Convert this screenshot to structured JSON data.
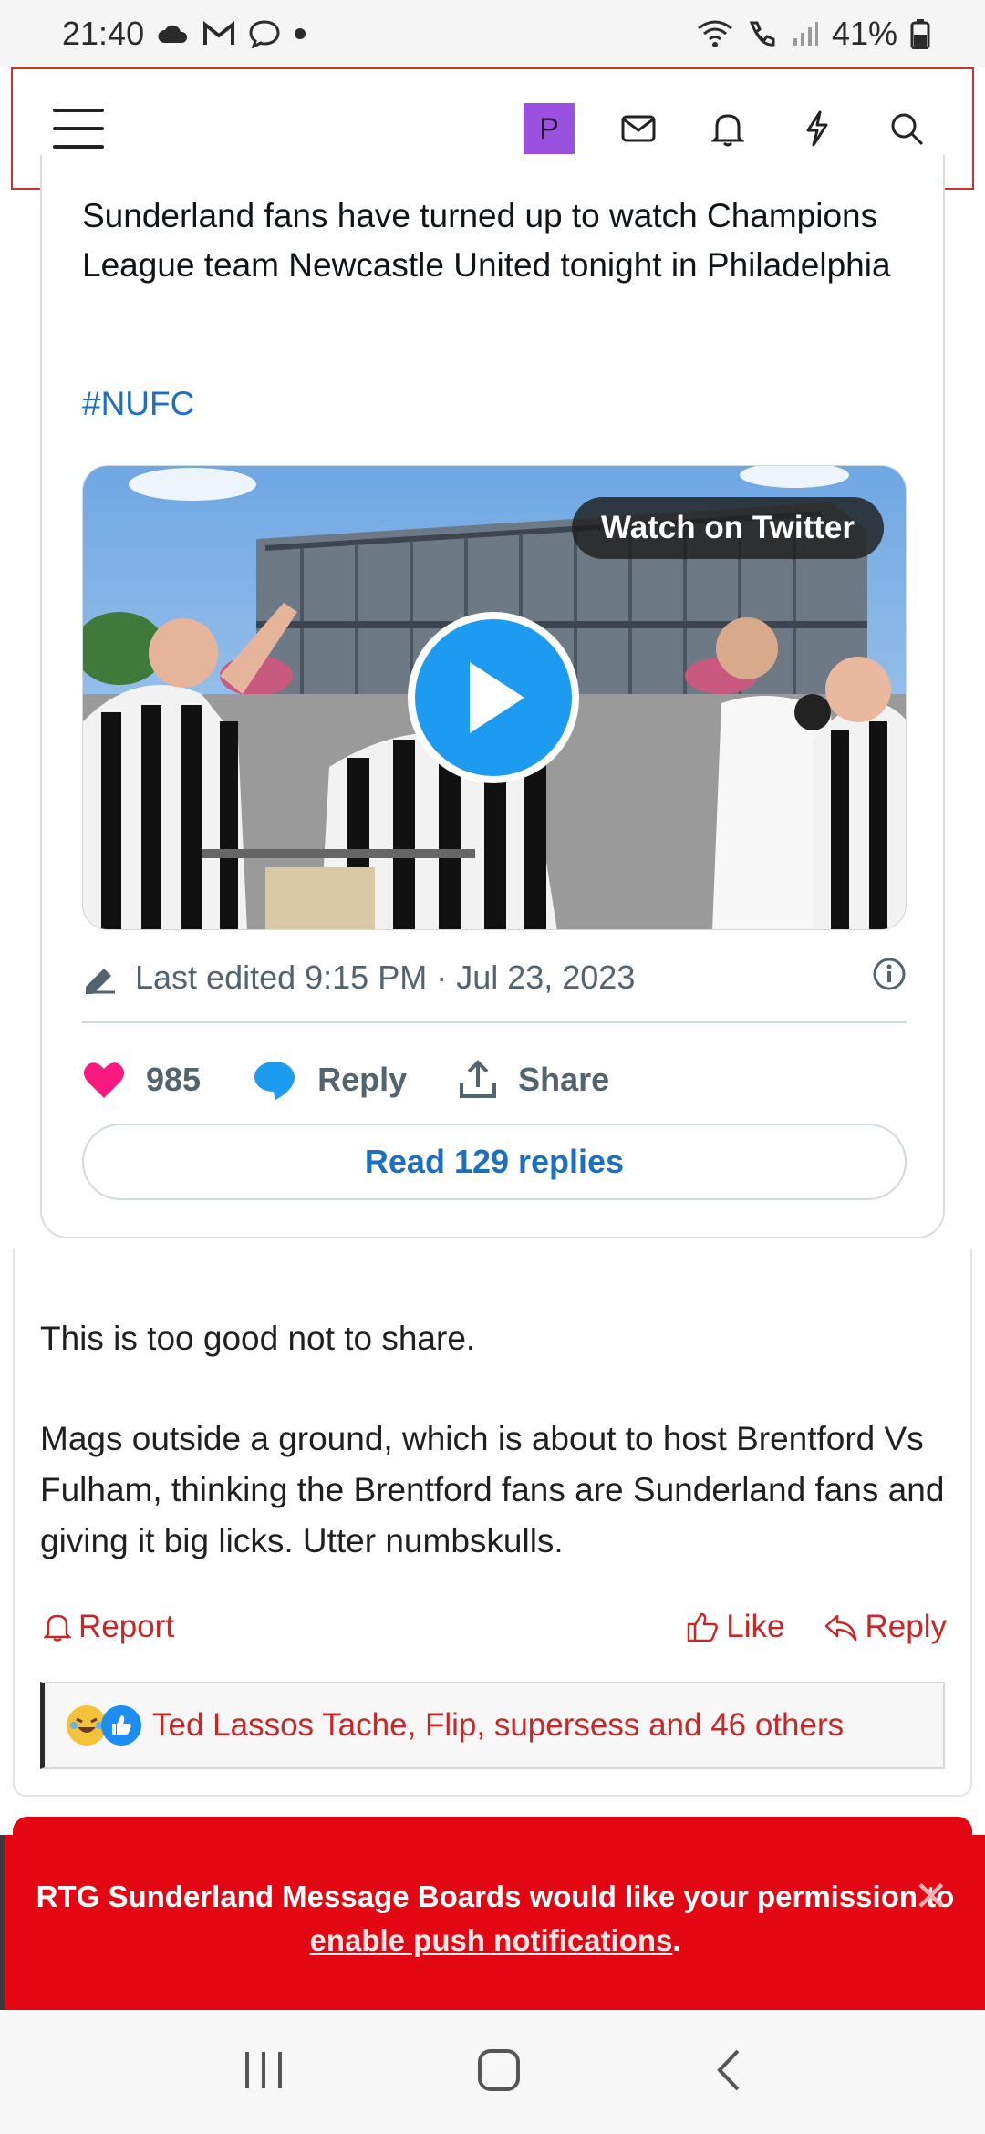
{
  "status_bar": {
    "time": "21:40",
    "battery": "41%",
    "icons": [
      "cloud-icon",
      "gmail-icon",
      "chat-bubble-icon",
      "dot-icon",
      "wifi-icon",
      "call-icon",
      "signal-icon",
      "battery-icon"
    ]
  },
  "header": {
    "avatar_letter": "P",
    "icons": [
      "menu-icon",
      "mail-icon",
      "bell-icon",
      "lightning-icon",
      "search-icon"
    ],
    "avatar_color": "#9b51e0"
  },
  "tweet": {
    "text": "Sunderland fans have turned up to watch Champions League team Newcastle United tonight in Philadelphia",
    "hashtag": "#NUFC",
    "watch_label": "Watch on Twitter",
    "edited": "Last edited 9:15 PM · Jul 23, 2023",
    "likes": "985",
    "reply_label": "Reply",
    "share_label": "Share",
    "read_replies": "Read 129 replies"
  },
  "post": {
    "paragraph1": "This is too good not to share.",
    "paragraph2": "Mags outside a ground, which is about to host Brentford Vs Fulham, thinking the Brentford fans are Sunderland fans and giving it big licks. Utter numbskulls.",
    "report_label": "Report",
    "like_label": "Like",
    "reply_label": "Reply",
    "reactions_text": "Ted Lassos Tache, Flip, supersess and 46 others"
  },
  "notification": {
    "text_before": "RTG Sunderland Message Boards would like your permission to ",
    "link": "enable push notifications",
    "text_after": ".",
    "close": "✕"
  },
  "colors": {
    "accent_red": "#e30613",
    "link_blue": "#1d6fc2",
    "twitter_blue": "#1d9bf0",
    "like_pink": "#f91880"
  }
}
